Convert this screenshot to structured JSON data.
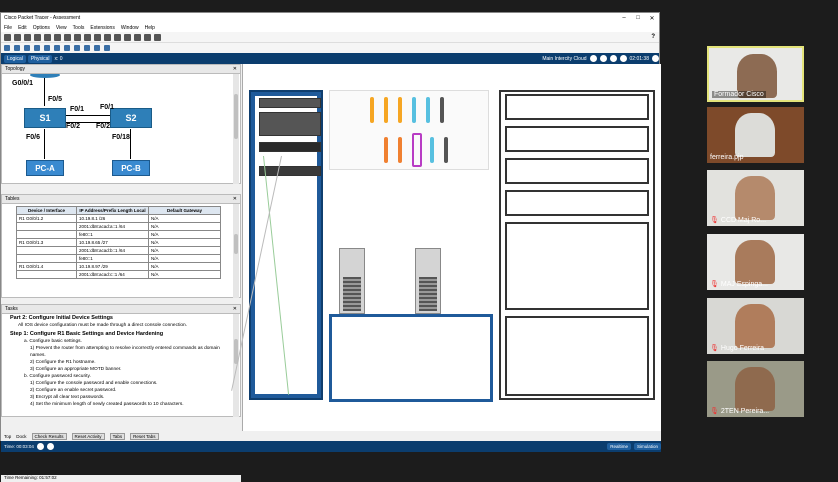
{
  "window": {
    "title": "Cisco Packet Tracer - Assessment",
    "minimize": "–",
    "maximize": "□",
    "close": "✕"
  },
  "menu": [
    "File",
    "Edit",
    "Options",
    "View",
    "Tools",
    "Extensions",
    "Window",
    "Help"
  ],
  "toolbar": {
    "help_icon": "?"
  },
  "nav": {
    "logical_tab": "Logical",
    "physical_tab": "Physical",
    "coords": "x: 0",
    "location": "Main Intercity Cloud",
    "time": "02:01:38"
  },
  "topology": {
    "panel_title": "Topology",
    "labels": {
      "g0": "G0/0/1",
      "f05": "F0/5",
      "f01": "F0/1",
      "f02": "F0/2",
      "f06": "F0/6",
      "f018": "F0/18",
      "s1": "S1",
      "s2": "S2",
      "pca": "PC-A",
      "pcb": "PC-B"
    }
  },
  "tables": {
    "panel_title": "Tables",
    "headers": [
      "Device / Interface",
      "IP Address/Prefix Length Local",
      "Default Gateway"
    ],
    "rows": [
      [
        "R1 G0/0/1.2",
        "10.19.8.1 /26",
        "N/A"
      ],
      [
        "",
        "2001:db8:acad:a::1 /64",
        "N/A"
      ],
      [
        "",
        "fe80::1",
        "N/A"
      ],
      [
        "R1 G0/0/1.3",
        "10.19.8.65 /27",
        "N/A"
      ],
      [
        "",
        "2001:db8:acad:b::1 /64",
        "N/A"
      ],
      [
        "",
        "fe80::1",
        "N/A"
      ],
      [
        "R1 G0/0/1.4",
        "10.19.8.97 /29",
        "N/A"
      ],
      [
        "",
        "2001:db8:acad:c::1 /64",
        "N/A"
      ]
    ]
  },
  "tasks": {
    "panel_title": "Tasks",
    "part": "Part 2: Configure Initial Device Settings",
    "note": "All IOS device configuration must be made through a direct console connection.",
    "step": "Step 1: Configure R1 Basic Settings and Device Hardening",
    "items": [
      {
        "level": 1,
        "text": "a.  Configure basic settings."
      },
      {
        "level": 2,
        "text": "1)  Prevent the router from attempting to resolve incorrectly entered commands as domain names."
      },
      {
        "level": 2,
        "text": "2)  Configure the R1 hostname."
      },
      {
        "level": 2,
        "text": "3)  Configure an appropriate MOTD banner."
      },
      {
        "level": 1,
        "text": "b.  Configure password security."
      },
      {
        "level": 2,
        "text": "1)  Configure the console password and enable connections."
      },
      {
        "level": 2,
        "text": "2)  Configure an enable secret password."
      },
      {
        "level": 2,
        "text": "3)  Encrypt all clear text passwords."
      },
      {
        "level": 2,
        "text": "4)  Set the minimum length of newly created passwords to 10 characters."
      }
    ]
  },
  "status": {
    "time_remaining": "Time Remaining: 01:57:02",
    "top": "Top",
    "dock": "Dock",
    "check_results": "Check Results",
    "reset_activity": "Reset Activity",
    "tabs": "Tabs",
    "reset_tabs": "Reset Tabs",
    "sim_time": "Time: 00:03:04",
    "realtime": "Realtime",
    "simulation": "Simulation"
  },
  "participants": [
    {
      "name": "Formador Cisco",
      "muted": false,
      "active": true
    },
    {
      "name": "ferreira.pjp",
      "muted": false,
      "active": false
    },
    {
      "name": "CCD Maj Ro...",
      "muted": true,
      "active": false
    },
    {
      "name": "MAJ Espinga...",
      "muted": true,
      "active": false
    },
    {
      "name": "Hugo Ferreira",
      "muted": true,
      "active": false
    },
    {
      "name": "2TEN Pereira...",
      "muted": true,
      "active": false
    }
  ]
}
